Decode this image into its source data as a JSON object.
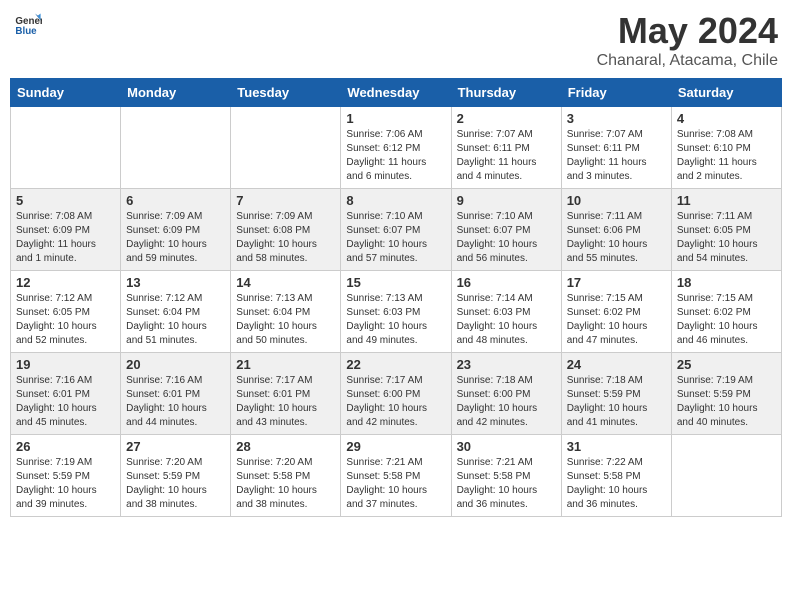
{
  "header": {
    "logo_general": "General",
    "logo_blue": "Blue",
    "main_title": "May 2024",
    "subtitle": "Chanaral, Atacama, Chile"
  },
  "days_of_week": [
    "Sunday",
    "Monday",
    "Tuesday",
    "Wednesday",
    "Thursday",
    "Friday",
    "Saturday"
  ],
  "weeks": [
    {
      "shaded": false,
      "days": [
        {
          "num": "",
          "info": ""
        },
        {
          "num": "",
          "info": ""
        },
        {
          "num": "",
          "info": ""
        },
        {
          "num": "1",
          "info": "Sunrise: 7:06 AM\nSunset: 6:12 PM\nDaylight: 11 hours\nand 6 minutes."
        },
        {
          "num": "2",
          "info": "Sunrise: 7:07 AM\nSunset: 6:11 PM\nDaylight: 11 hours\nand 4 minutes."
        },
        {
          "num": "3",
          "info": "Sunrise: 7:07 AM\nSunset: 6:11 PM\nDaylight: 11 hours\nand 3 minutes."
        },
        {
          "num": "4",
          "info": "Sunrise: 7:08 AM\nSunset: 6:10 PM\nDaylight: 11 hours\nand 2 minutes."
        }
      ]
    },
    {
      "shaded": true,
      "days": [
        {
          "num": "5",
          "info": "Sunrise: 7:08 AM\nSunset: 6:09 PM\nDaylight: 11 hours\nand 1 minute."
        },
        {
          "num": "6",
          "info": "Sunrise: 7:09 AM\nSunset: 6:09 PM\nDaylight: 10 hours\nand 59 minutes."
        },
        {
          "num": "7",
          "info": "Sunrise: 7:09 AM\nSunset: 6:08 PM\nDaylight: 10 hours\nand 58 minutes."
        },
        {
          "num": "8",
          "info": "Sunrise: 7:10 AM\nSunset: 6:07 PM\nDaylight: 10 hours\nand 57 minutes."
        },
        {
          "num": "9",
          "info": "Sunrise: 7:10 AM\nSunset: 6:07 PM\nDaylight: 10 hours\nand 56 minutes."
        },
        {
          "num": "10",
          "info": "Sunrise: 7:11 AM\nSunset: 6:06 PM\nDaylight: 10 hours\nand 55 minutes."
        },
        {
          "num": "11",
          "info": "Sunrise: 7:11 AM\nSunset: 6:05 PM\nDaylight: 10 hours\nand 54 minutes."
        }
      ]
    },
    {
      "shaded": false,
      "days": [
        {
          "num": "12",
          "info": "Sunrise: 7:12 AM\nSunset: 6:05 PM\nDaylight: 10 hours\nand 52 minutes."
        },
        {
          "num": "13",
          "info": "Sunrise: 7:12 AM\nSunset: 6:04 PM\nDaylight: 10 hours\nand 51 minutes."
        },
        {
          "num": "14",
          "info": "Sunrise: 7:13 AM\nSunset: 6:04 PM\nDaylight: 10 hours\nand 50 minutes."
        },
        {
          "num": "15",
          "info": "Sunrise: 7:13 AM\nSunset: 6:03 PM\nDaylight: 10 hours\nand 49 minutes."
        },
        {
          "num": "16",
          "info": "Sunrise: 7:14 AM\nSunset: 6:03 PM\nDaylight: 10 hours\nand 48 minutes."
        },
        {
          "num": "17",
          "info": "Sunrise: 7:15 AM\nSunset: 6:02 PM\nDaylight: 10 hours\nand 47 minutes."
        },
        {
          "num": "18",
          "info": "Sunrise: 7:15 AM\nSunset: 6:02 PM\nDaylight: 10 hours\nand 46 minutes."
        }
      ]
    },
    {
      "shaded": true,
      "days": [
        {
          "num": "19",
          "info": "Sunrise: 7:16 AM\nSunset: 6:01 PM\nDaylight: 10 hours\nand 45 minutes."
        },
        {
          "num": "20",
          "info": "Sunrise: 7:16 AM\nSunset: 6:01 PM\nDaylight: 10 hours\nand 44 minutes."
        },
        {
          "num": "21",
          "info": "Sunrise: 7:17 AM\nSunset: 6:01 PM\nDaylight: 10 hours\nand 43 minutes."
        },
        {
          "num": "22",
          "info": "Sunrise: 7:17 AM\nSunset: 6:00 PM\nDaylight: 10 hours\nand 42 minutes."
        },
        {
          "num": "23",
          "info": "Sunrise: 7:18 AM\nSunset: 6:00 PM\nDaylight: 10 hours\nand 42 minutes."
        },
        {
          "num": "24",
          "info": "Sunrise: 7:18 AM\nSunset: 5:59 PM\nDaylight: 10 hours\nand 41 minutes."
        },
        {
          "num": "25",
          "info": "Sunrise: 7:19 AM\nSunset: 5:59 PM\nDaylight: 10 hours\nand 40 minutes."
        }
      ]
    },
    {
      "shaded": false,
      "days": [
        {
          "num": "26",
          "info": "Sunrise: 7:19 AM\nSunset: 5:59 PM\nDaylight: 10 hours\nand 39 minutes."
        },
        {
          "num": "27",
          "info": "Sunrise: 7:20 AM\nSunset: 5:59 PM\nDaylight: 10 hours\nand 38 minutes."
        },
        {
          "num": "28",
          "info": "Sunrise: 7:20 AM\nSunset: 5:58 PM\nDaylight: 10 hours\nand 38 minutes."
        },
        {
          "num": "29",
          "info": "Sunrise: 7:21 AM\nSunset: 5:58 PM\nDaylight: 10 hours\nand 37 minutes."
        },
        {
          "num": "30",
          "info": "Sunrise: 7:21 AM\nSunset: 5:58 PM\nDaylight: 10 hours\nand 36 minutes."
        },
        {
          "num": "31",
          "info": "Sunrise: 7:22 AM\nSunset: 5:58 PM\nDaylight: 10 hours\nand 36 minutes."
        },
        {
          "num": "",
          "info": ""
        }
      ]
    }
  ]
}
